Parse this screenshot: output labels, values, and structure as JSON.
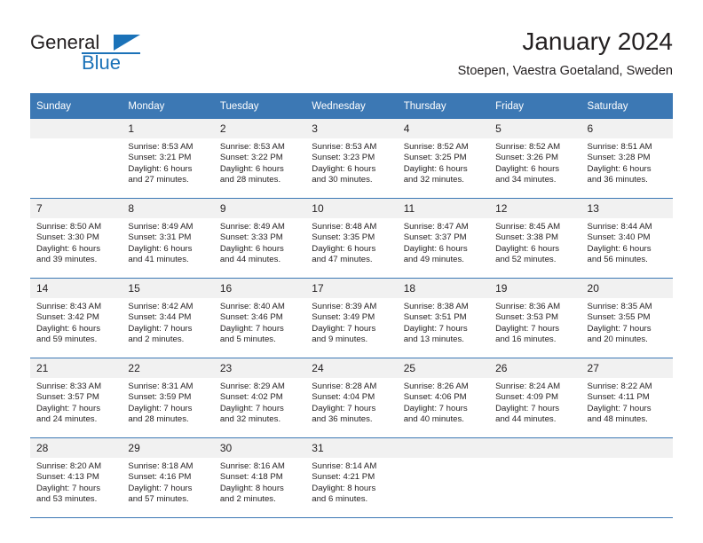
{
  "brand": {
    "name_dark": "General",
    "name_blue": "Blue",
    "accent_color": "#1b72b8"
  },
  "header": {
    "title": "January 2024",
    "subtitle": "Stoepen, Vaestra Goetaland, Sweden",
    "header_bg": "#3c78b4",
    "daynum_bg": "#f1f1f1"
  },
  "weekday_headers": [
    "Sunday",
    "Monday",
    "Tuesday",
    "Wednesday",
    "Thursday",
    "Friday",
    "Saturday"
  ],
  "weeks": [
    [
      {
        "day": "",
        "sunrise": "",
        "sunset": "",
        "daylight1": "",
        "daylight2": ""
      },
      {
        "day": "1",
        "sunrise": "Sunrise: 8:53 AM",
        "sunset": "Sunset: 3:21 PM",
        "daylight1": "Daylight: 6 hours",
        "daylight2": "and 27 minutes."
      },
      {
        "day": "2",
        "sunrise": "Sunrise: 8:53 AM",
        "sunset": "Sunset: 3:22 PM",
        "daylight1": "Daylight: 6 hours",
        "daylight2": "and 28 minutes."
      },
      {
        "day": "3",
        "sunrise": "Sunrise: 8:53 AM",
        "sunset": "Sunset: 3:23 PM",
        "daylight1": "Daylight: 6 hours",
        "daylight2": "and 30 minutes."
      },
      {
        "day": "4",
        "sunrise": "Sunrise: 8:52 AM",
        "sunset": "Sunset: 3:25 PM",
        "daylight1": "Daylight: 6 hours",
        "daylight2": "and 32 minutes."
      },
      {
        "day": "5",
        "sunrise": "Sunrise: 8:52 AM",
        "sunset": "Sunset: 3:26 PM",
        "daylight1": "Daylight: 6 hours",
        "daylight2": "and 34 minutes."
      },
      {
        "day": "6",
        "sunrise": "Sunrise: 8:51 AM",
        "sunset": "Sunset: 3:28 PM",
        "daylight1": "Daylight: 6 hours",
        "daylight2": "and 36 minutes."
      }
    ],
    [
      {
        "day": "7",
        "sunrise": "Sunrise: 8:50 AM",
        "sunset": "Sunset: 3:30 PM",
        "daylight1": "Daylight: 6 hours",
        "daylight2": "and 39 minutes."
      },
      {
        "day": "8",
        "sunrise": "Sunrise: 8:49 AM",
        "sunset": "Sunset: 3:31 PM",
        "daylight1": "Daylight: 6 hours",
        "daylight2": "and 41 minutes."
      },
      {
        "day": "9",
        "sunrise": "Sunrise: 8:49 AM",
        "sunset": "Sunset: 3:33 PM",
        "daylight1": "Daylight: 6 hours",
        "daylight2": "and 44 minutes."
      },
      {
        "day": "10",
        "sunrise": "Sunrise: 8:48 AM",
        "sunset": "Sunset: 3:35 PM",
        "daylight1": "Daylight: 6 hours",
        "daylight2": "and 47 minutes."
      },
      {
        "day": "11",
        "sunrise": "Sunrise: 8:47 AM",
        "sunset": "Sunset: 3:37 PM",
        "daylight1": "Daylight: 6 hours",
        "daylight2": "and 49 minutes."
      },
      {
        "day": "12",
        "sunrise": "Sunrise: 8:45 AM",
        "sunset": "Sunset: 3:38 PM",
        "daylight1": "Daylight: 6 hours",
        "daylight2": "and 52 minutes."
      },
      {
        "day": "13",
        "sunrise": "Sunrise: 8:44 AM",
        "sunset": "Sunset: 3:40 PM",
        "daylight1": "Daylight: 6 hours",
        "daylight2": "and 56 minutes."
      }
    ],
    [
      {
        "day": "14",
        "sunrise": "Sunrise: 8:43 AM",
        "sunset": "Sunset: 3:42 PM",
        "daylight1": "Daylight: 6 hours",
        "daylight2": "and 59 minutes."
      },
      {
        "day": "15",
        "sunrise": "Sunrise: 8:42 AM",
        "sunset": "Sunset: 3:44 PM",
        "daylight1": "Daylight: 7 hours",
        "daylight2": "and 2 minutes."
      },
      {
        "day": "16",
        "sunrise": "Sunrise: 8:40 AM",
        "sunset": "Sunset: 3:46 PM",
        "daylight1": "Daylight: 7 hours",
        "daylight2": "and 5 minutes."
      },
      {
        "day": "17",
        "sunrise": "Sunrise: 8:39 AM",
        "sunset": "Sunset: 3:49 PM",
        "daylight1": "Daylight: 7 hours",
        "daylight2": "and 9 minutes."
      },
      {
        "day": "18",
        "sunrise": "Sunrise: 8:38 AM",
        "sunset": "Sunset: 3:51 PM",
        "daylight1": "Daylight: 7 hours",
        "daylight2": "and 13 minutes."
      },
      {
        "day": "19",
        "sunrise": "Sunrise: 8:36 AM",
        "sunset": "Sunset: 3:53 PM",
        "daylight1": "Daylight: 7 hours",
        "daylight2": "and 16 minutes."
      },
      {
        "day": "20",
        "sunrise": "Sunrise: 8:35 AM",
        "sunset": "Sunset: 3:55 PM",
        "daylight1": "Daylight: 7 hours",
        "daylight2": "and 20 minutes."
      }
    ],
    [
      {
        "day": "21",
        "sunrise": "Sunrise: 8:33 AM",
        "sunset": "Sunset: 3:57 PM",
        "daylight1": "Daylight: 7 hours",
        "daylight2": "and 24 minutes."
      },
      {
        "day": "22",
        "sunrise": "Sunrise: 8:31 AM",
        "sunset": "Sunset: 3:59 PM",
        "daylight1": "Daylight: 7 hours",
        "daylight2": "and 28 minutes."
      },
      {
        "day": "23",
        "sunrise": "Sunrise: 8:29 AM",
        "sunset": "Sunset: 4:02 PM",
        "daylight1": "Daylight: 7 hours",
        "daylight2": "and 32 minutes."
      },
      {
        "day": "24",
        "sunrise": "Sunrise: 8:28 AM",
        "sunset": "Sunset: 4:04 PM",
        "daylight1": "Daylight: 7 hours",
        "daylight2": "and 36 minutes."
      },
      {
        "day": "25",
        "sunrise": "Sunrise: 8:26 AM",
        "sunset": "Sunset: 4:06 PM",
        "daylight1": "Daylight: 7 hours",
        "daylight2": "and 40 minutes."
      },
      {
        "day": "26",
        "sunrise": "Sunrise: 8:24 AM",
        "sunset": "Sunset: 4:09 PM",
        "daylight1": "Daylight: 7 hours",
        "daylight2": "and 44 minutes."
      },
      {
        "day": "27",
        "sunrise": "Sunrise: 8:22 AM",
        "sunset": "Sunset: 4:11 PM",
        "daylight1": "Daylight: 7 hours",
        "daylight2": "and 48 minutes."
      }
    ],
    [
      {
        "day": "28",
        "sunrise": "Sunrise: 8:20 AM",
        "sunset": "Sunset: 4:13 PM",
        "daylight1": "Daylight: 7 hours",
        "daylight2": "and 53 minutes."
      },
      {
        "day": "29",
        "sunrise": "Sunrise: 8:18 AM",
        "sunset": "Sunset: 4:16 PM",
        "daylight1": "Daylight: 7 hours",
        "daylight2": "and 57 minutes."
      },
      {
        "day": "30",
        "sunrise": "Sunrise: 8:16 AM",
        "sunset": "Sunset: 4:18 PM",
        "daylight1": "Daylight: 8 hours",
        "daylight2": "and 2 minutes."
      },
      {
        "day": "31",
        "sunrise": "Sunrise: 8:14 AM",
        "sunset": "Sunset: 4:21 PM",
        "daylight1": "Daylight: 8 hours",
        "daylight2": "and 6 minutes."
      },
      {
        "day": "",
        "sunrise": "",
        "sunset": "",
        "daylight1": "",
        "daylight2": ""
      },
      {
        "day": "",
        "sunrise": "",
        "sunset": "",
        "daylight1": "",
        "daylight2": ""
      },
      {
        "day": "",
        "sunrise": "",
        "sunset": "",
        "daylight1": "",
        "daylight2": ""
      }
    ]
  ]
}
